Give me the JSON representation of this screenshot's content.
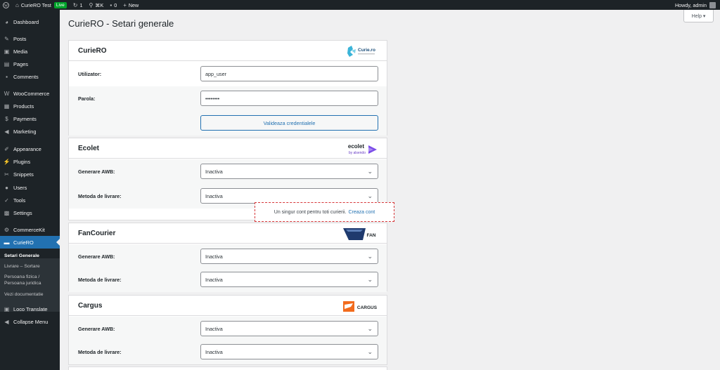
{
  "adminbar": {
    "site_name": "CurieRO Test",
    "live_badge": "Live",
    "updates_count": "1",
    "search_shortcut": "⌘K",
    "comments_count": "0",
    "new_label": "New",
    "howdy": "Howdy, admin"
  },
  "sidebar": {
    "items": [
      {
        "label": "Dashboard",
        "icon": "dashboard-icon"
      },
      {
        "label": "Posts",
        "icon": "pin-icon"
      },
      {
        "label": "Media",
        "icon": "media-icon"
      },
      {
        "label": "Pages",
        "icon": "pages-icon"
      },
      {
        "label": "Comments",
        "icon": "comment-icon"
      },
      {
        "label": "WooCommerce",
        "icon": "woocommerce-icon"
      },
      {
        "label": "Products",
        "icon": "products-icon"
      },
      {
        "label": "Payments",
        "icon": "payments-icon"
      },
      {
        "label": "Marketing",
        "icon": "megaphone-icon"
      },
      {
        "label": "Appearance",
        "icon": "brush-icon"
      },
      {
        "label": "Plugins",
        "icon": "plugin-icon"
      },
      {
        "label": "Snippets",
        "icon": "scissors-icon"
      },
      {
        "label": "Users",
        "icon": "users-icon"
      },
      {
        "label": "Tools",
        "icon": "wrench-icon"
      },
      {
        "label": "Settings",
        "icon": "settings-icon"
      },
      {
        "label": "CommerceKit",
        "icon": "gear-icon"
      },
      {
        "label": "CurieRO",
        "icon": "truck-icon"
      },
      {
        "label": "Loco Translate",
        "icon": "translate-icon"
      },
      {
        "label": "Collapse Menu",
        "icon": "collapse-icon"
      }
    ],
    "submenu": {
      "setari": "Setari Generale",
      "livrare": "Livrare – Sortare",
      "persoana": "Persoana fizica / Persoana juridica",
      "docs": "Vezi documentatie"
    }
  },
  "help_label": "Help ▾",
  "page_title": "CurieRO - Setari generale",
  "curiero": {
    "title": "CurieRO",
    "logo_text": "Curie.ro",
    "user_label": "Utilizator:",
    "user_value": "app_user",
    "pass_label": "Parola:",
    "pass_value": "••••••••",
    "validate_button": "Valideaza credentialele"
  },
  "ecolet": {
    "title": "Ecolet",
    "logo_word": "ecolet",
    "logo_sub": "by alsendo",
    "awb_label": "Generare AWB:",
    "awb_value": "Inactiva",
    "delivery_label": "Metoda de livrare:",
    "delivery_value": "Inactiva"
  },
  "note": {
    "text": "Un singur cont pentru toti curierii.",
    "link": "Creaza cont"
  },
  "fancourier": {
    "title": "FanCourier",
    "logo_text": "FAN",
    "awb_label": "Generare AWB:",
    "awb_value": "Inactiva",
    "delivery_label": "Metoda de livrare:",
    "delivery_value": "Inactiva"
  },
  "cargus": {
    "title": "Cargus",
    "logo_text": "CARGUS",
    "awb_label": "Generare AWB:",
    "awb_value": "Inactiva",
    "delivery_label": "Metoda de livrare:",
    "delivery_value": "Inactiva"
  },
  "colors": {
    "sidebar_bg": "#1d2327",
    "accent": "#2271b1",
    "live_badge": "#00a32a",
    "note_border": "#d63638"
  }
}
